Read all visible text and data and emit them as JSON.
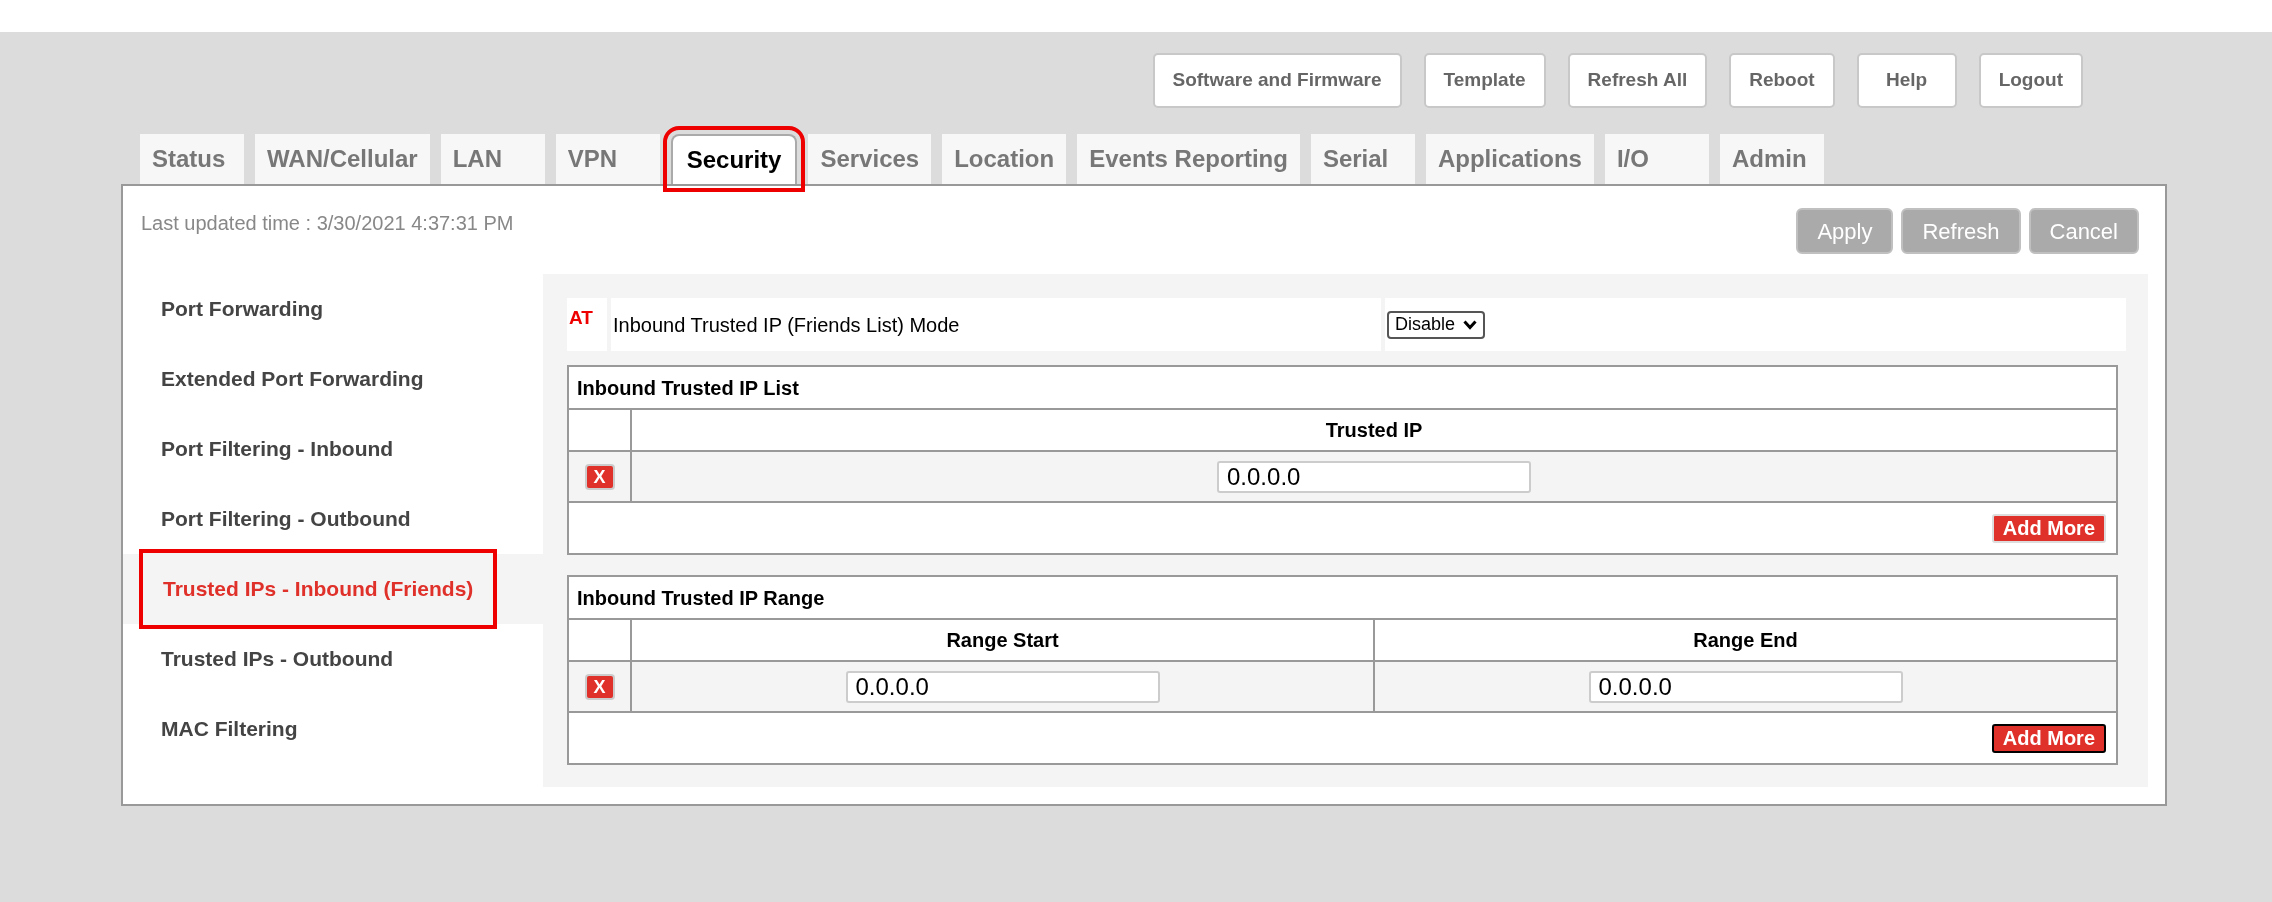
{
  "header_buttons": [
    "Software and Firmware",
    "Template",
    "Refresh All",
    "Reboot",
    "Help",
    "Logout"
  ],
  "tabs": [
    {
      "label": "Status",
      "selected": false
    },
    {
      "label": "WAN/Cellular",
      "selected": false
    },
    {
      "label": "LAN",
      "selected": false
    },
    {
      "label": "VPN",
      "selected": false
    },
    {
      "label": "Security",
      "selected": true
    },
    {
      "label": "Services",
      "selected": false
    },
    {
      "label": "Location",
      "selected": false
    },
    {
      "label": "Events Reporting",
      "selected": false
    },
    {
      "label": "Serial",
      "selected": false
    },
    {
      "label": "Applications",
      "selected": false
    },
    {
      "label": "I/O",
      "selected": false
    },
    {
      "label": "Admin",
      "selected": false
    }
  ],
  "last_updated": "Last updated time : 3/30/2021 4:37:31 PM",
  "action_buttons": [
    "Apply",
    "Refresh",
    "Cancel"
  ],
  "sidebar": {
    "items": [
      {
        "label": "Port Forwarding",
        "selected": false
      },
      {
        "label": "Extended Port Forwarding",
        "selected": false
      },
      {
        "label": "Port Filtering - Inbound",
        "selected": false
      },
      {
        "label": "Port Filtering - Outbound",
        "selected": false
      },
      {
        "label": "Trusted IPs - Inbound (Friends)",
        "selected": true
      },
      {
        "label": "Trusted IPs - Outbound",
        "selected": false
      },
      {
        "label": "MAC Filtering",
        "selected": false
      }
    ]
  },
  "mode_row": {
    "badge": "AT",
    "label": "Inbound Trusted IP (Friends List) Mode",
    "select": {
      "value": "Disable"
    }
  },
  "tables": [
    {
      "title": "Inbound Trusted IP List",
      "columns": [
        "Trusted IP"
      ],
      "rows": [
        {
          "delete_label": "X",
          "values": [
            "0.0.0.0"
          ]
        }
      ],
      "add_button": {
        "label": "Add More",
        "focused": false
      }
    },
    {
      "title": "Inbound Trusted IP Range",
      "columns": [
        "Range Start",
        "Range End"
      ],
      "rows": [
        {
          "delete_label": "X",
          "values": [
            "0.0.0.0",
            "0.0.0.0"
          ]
        }
      ],
      "add_button": {
        "label": "Add More",
        "focused": true
      }
    }
  ]
}
